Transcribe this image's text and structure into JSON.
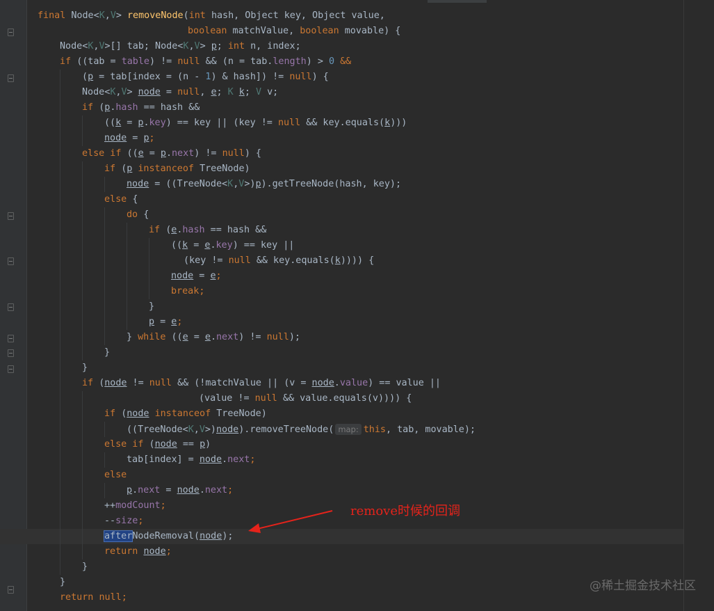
{
  "editor": {
    "lines": [
      [
        "final ",
        "Node<",
        "K",
        ",",
        "V",
        "> ",
        "removeNode",
        "(",
        "int ",
        "hash, Object key, Object value,"
      ],
      [
        "boolean ",
        "matchValue, ",
        "boolean ",
        "movable) {"
      ],
      [
        "Node<",
        "K",
        ",",
        "V",
        ">[] tab; Node<",
        "K",
        ",",
        "V",
        "> ",
        "p",
        "; ",
        "int ",
        "n, index;"
      ],
      [
        "if ",
        "((tab = ",
        "table",
        ") != ",
        "null ",
        "&& (n = tab.",
        "length",
        ") > ",
        "0 ",
        "&&"
      ],
      [
        "(",
        "p",
        " = tab[index = (n - ",
        "1",
        ") & hash]) != ",
        "null",
        ") {"
      ],
      [
        "Node<",
        "K",
        ",",
        "V",
        "> ",
        "node",
        " = ",
        "null",
        ", ",
        "e",
        "; ",
        "K ",
        "k",
        "; ",
        "V ",
        "v;"
      ],
      [
        "if ",
        "(",
        "p",
        ".",
        "hash",
        " == hash &&"
      ],
      [
        "((",
        "k",
        " = ",
        "p",
        ".",
        "key",
        ") == key || (key != ",
        "null ",
        "&& key.equals(",
        "k",
        ")))"
      ],
      [
        "node",
        " = ",
        "p",
        ";"
      ],
      [
        "else if ",
        "((",
        "e",
        " = ",
        "p",
        ".",
        "next",
        ") != ",
        "null",
        ") {"
      ],
      [
        "if ",
        "(",
        "p",
        " ",
        "instanceof ",
        "TreeNode)"
      ],
      [
        "node",
        " = ((TreeNode<",
        "K",
        ",",
        "V",
        ">)",
        "p",
        ").getTreeNode(hash, key);"
      ],
      [
        "else ",
        "{"
      ],
      [
        "do ",
        "{"
      ],
      [
        "if ",
        "(",
        "e",
        ".",
        "hash",
        " == hash &&"
      ],
      [
        "((",
        "k",
        " = ",
        "e",
        ".",
        "key",
        ") == key ||"
      ],
      [
        " (key != ",
        "null ",
        "&& key.equals(",
        "k",
        ")))) {"
      ],
      [
        "node",
        " = ",
        "e",
        ";"
      ],
      [
        "break",
        ";"
      ],
      [
        "}"
      ],
      [
        "p",
        " = ",
        "e",
        ";"
      ],
      [
        "} ",
        "while ",
        "((",
        "e",
        " = ",
        "e",
        ".",
        "next",
        ") != ",
        "null",
        ");"
      ],
      [
        "}"
      ],
      [
        "}"
      ],
      [
        "if ",
        "(",
        "node",
        " != ",
        "null ",
        "&& (!matchValue || (v = ",
        "node",
        ".",
        "value",
        ") == value ||"
      ],
      [
        "(value != ",
        "null ",
        "&& value.equals(v)))) {"
      ],
      [
        "if ",
        "(",
        "node",
        " ",
        "instanceof ",
        "TreeNode)"
      ],
      [
        "((TreeNode<",
        "K",
        ",",
        "V",
        ">)",
        "node",
        ").removeTreeNode(",
        "map:",
        "this",
        ", tab, movable);"
      ],
      [
        "else if ",
        "(",
        "node",
        " == ",
        "p",
        ")"
      ],
      [
        "tab[index] = ",
        "node",
        ".",
        "next",
        ";"
      ],
      [
        "else"
      ],
      [
        "p",
        ".",
        "next",
        " = ",
        "node",
        ".",
        "next",
        ";"
      ],
      [
        "++",
        "modCount",
        ";"
      ],
      [
        "--",
        "size",
        ";"
      ],
      [
        "after",
        "NodeRemoval",
        "(",
        "node",
        ");"
      ],
      [
        "return ",
        "node",
        ";"
      ],
      [
        "}"
      ],
      [
        "}"
      ],
      [
        "return ",
        "null",
        ";"
      ]
    ]
  },
  "annotation": {
    "text": "remove时候的回调",
    "color": "#e5231b"
  },
  "watermark": "@稀土掘金技术社区",
  "colors": {
    "background": "#2b2b2b",
    "keyword": "#cc7832",
    "method_decl": "#ffc66d",
    "field": "#9876aa",
    "type_param": "#507874",
    "number": "#6897bb",
    "plain": "#a9b7c6"
  }
}
